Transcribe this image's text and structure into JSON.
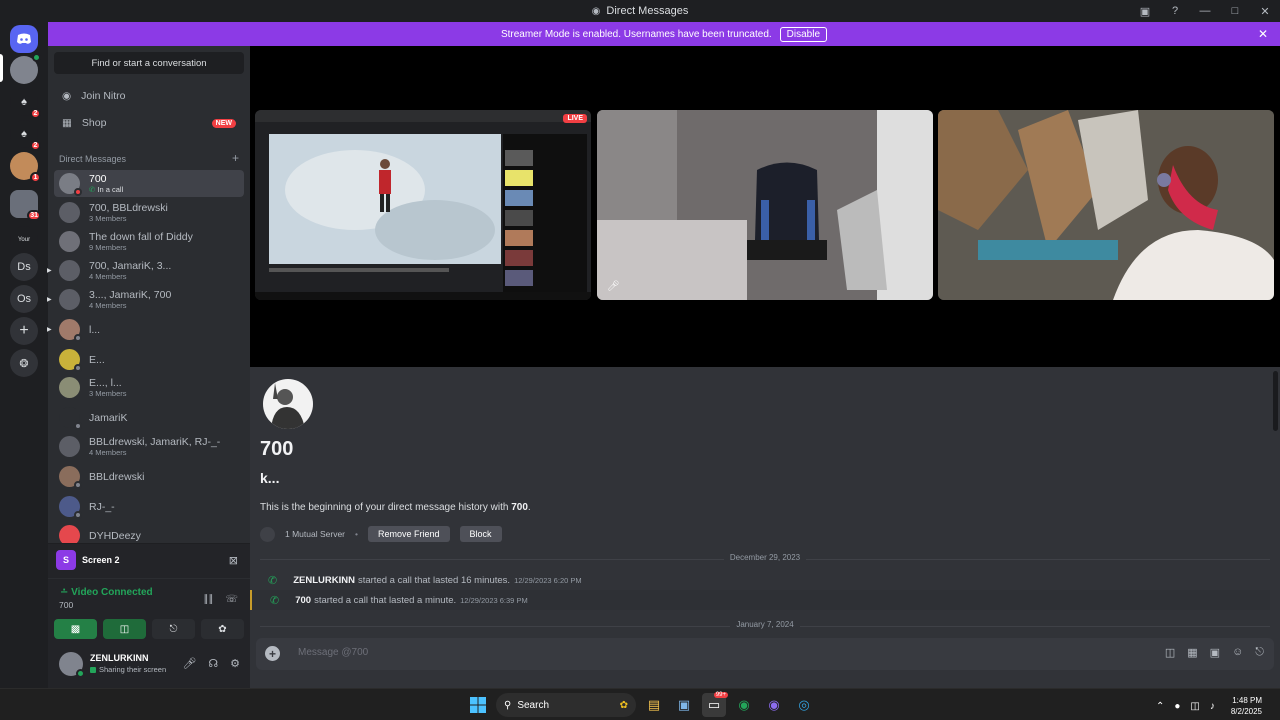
{
  "window": {
    "title": "Direct Messages"
  },
  "banner": {
    "text": "Streamer Mode is enabled. Usernames have been truncated.",
    "disable_label": "Disable"
  },
  "guilds": [
    {
      "label": "",
      "badge": ""
    },
    {
      "label": "",
      "badge": ""
    },
    {
      "label": "",
      "badge": "2"
    },
    {
      "label": "",
      "badge": "2"
    },
    {
      "label": "",
      "badge": "1"
    },
    {
      "label": "",
      "badge": "31"
    },
    {
      "label": "Your",
      "badge": ""
    },
    {
      "label": "Ds",
      "badge": ""
    },
    {
      "label": "Os",
      "badge": ""
    }
  ],
  "dm_sidebar": {
    "search_label": "Find or start a conversation",
    "nav": [
      {
        "label": "Join Nitro"
      },
      {
        "label": "Shop",
        "badge": "NEW"
      }
    ],
    "header": "Direct Messages",
    "add_icon": "+",
    "items": [
      {
        "name": "700",
        "sub": "In a call",
        "call": true
      },
      {
        "name": "700, BBLdrewski",
        "sub": "3 Members"
      },
      {
        "name": "The down fall of Diddy",
        "sub": "9 Members"
      },
      {
        "name": "700, JamariK, 3...",
        "sub": "4 Members"
      },
      {
        "name": "3..., JamariK, 700",
        "sub": "4 Members"
      },
      {
        "name": "l...",
        "sub": ""
      },
      {
        "name": "E...",
        "sub": ""
      },
      {
        "name": "E..., l...",
        "sub": "3 Members"
      },
      {
        "name": "JamariK",
        "sub": ""
      },
      {
        "name": "BBLdrewski, JamariK, RJ-_-",
        "sub": "4 Members"
      },
      {
        "name": "BBLdrewski",
        "sub": ""
      },
      {
        "name": "RJ-_-",
        "sub": ""
      },
      {
        "name": "DYHDeezy",
        "sub": ""
      }
    ]
  },
  "voice_panel": {
    "screen_label": "Screen 2",
    "screen_initial": "S",
    "status": "Video Connected",
    "channel": "700"
  },
  "user_panel": {
    "name": "ZENLURKINN",
    "status": "Sharing their screen"
  },
  "stage": {
    "live_label": "LIVE"
  },
  "welcome": {
    "name": "700",
    "subtitle": "k...",
    "desc_prefix": "This is the beginning of your direct message history with ",
    "desc_name": "700",
    "desc_suffix": ".",
    "mutual": "1 Mutual Server",
    "remove_friend": "Remove Friend",
    "block": "Block"
  },
  "messages": {
    "date1": "December 29, 2023",
    "calls": [
      {
        "who": "ZENLURKINN",
        "text": "started a call that lasted 16 minutes.",
        "time": "12/29/2023 6:20 PM"
      },
      {
        "who": "700",
        "text": "started a call that lasted a minute.",
        "time": "12/29/2023 6:39 PM"
      }
    ],
    "date2": "January 7, 2024"
  },
  "composer": {
    "placeholder": "Message @700"
  },
  "taskbar": {
    "search_label": "Search",
    "time": "1:48 PM",
    "date": "8/2/2025",
    "notif_badge": "99+"
  },
  "colors": {
    "accent": "#5865f2",
    "banner": "#8c3ae6",
    "online": "#23a55a",
    "danger": "#f23f43"
  },
  "icons": [
    "discord-logo-icon",
    "search-icon",
    "help-icon",
    "phone-icon",
    "video-camera-icon",
    "screen-share-icon",
    "controller-icon",
    "soundboard-icon",
    "microphone-icon",
    "headphones-icon",
    "gear-icon",
    "gift-icon",
    "gif-icon",
    "sticker-icon",
    "emoji-icon",
    "windows-start-icon",
    "file-explorer-icon",
    "edge-browser-icon"
  ]
}
